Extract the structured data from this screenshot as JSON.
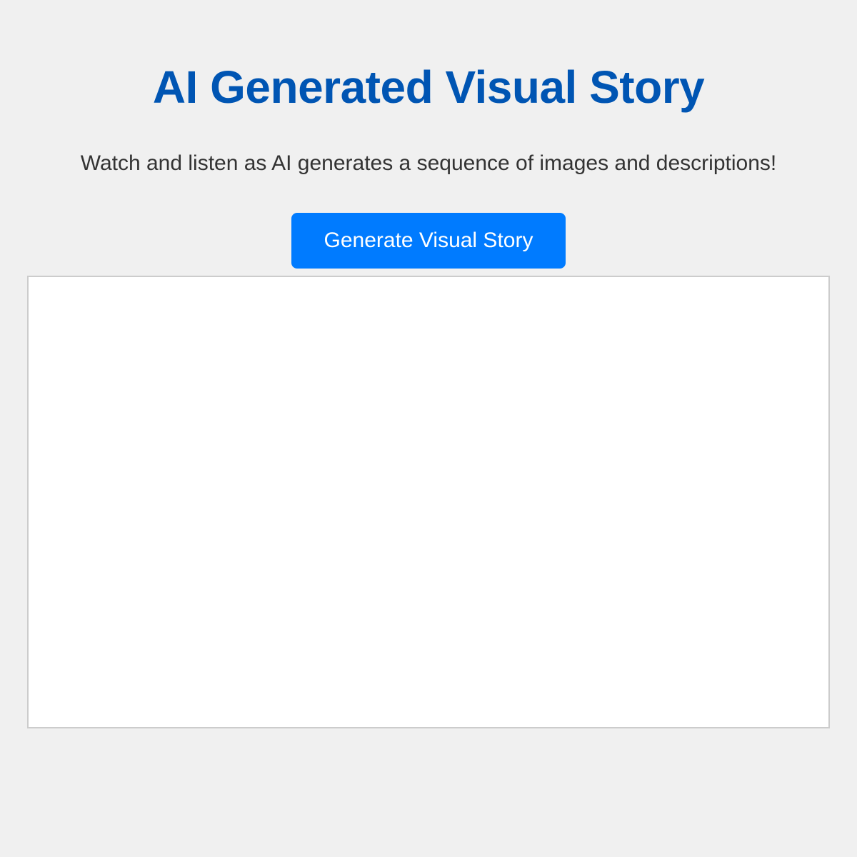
{
  "header": {
    "title": "AI Generated Visual Story",
    "subtitle": "Watch and listen as AI generates a sequence of images and descriptions!"
  },
  "actions": {
    "generate_label": "Generate Visual Story"
  },
  "colors": {
    "background": "#f0f0f0",
    "title": "#0055b3",
    "button": "#007bff",
    "button_text": "#ffffff",
    "panel_border": "#cccccc"
  }
}
